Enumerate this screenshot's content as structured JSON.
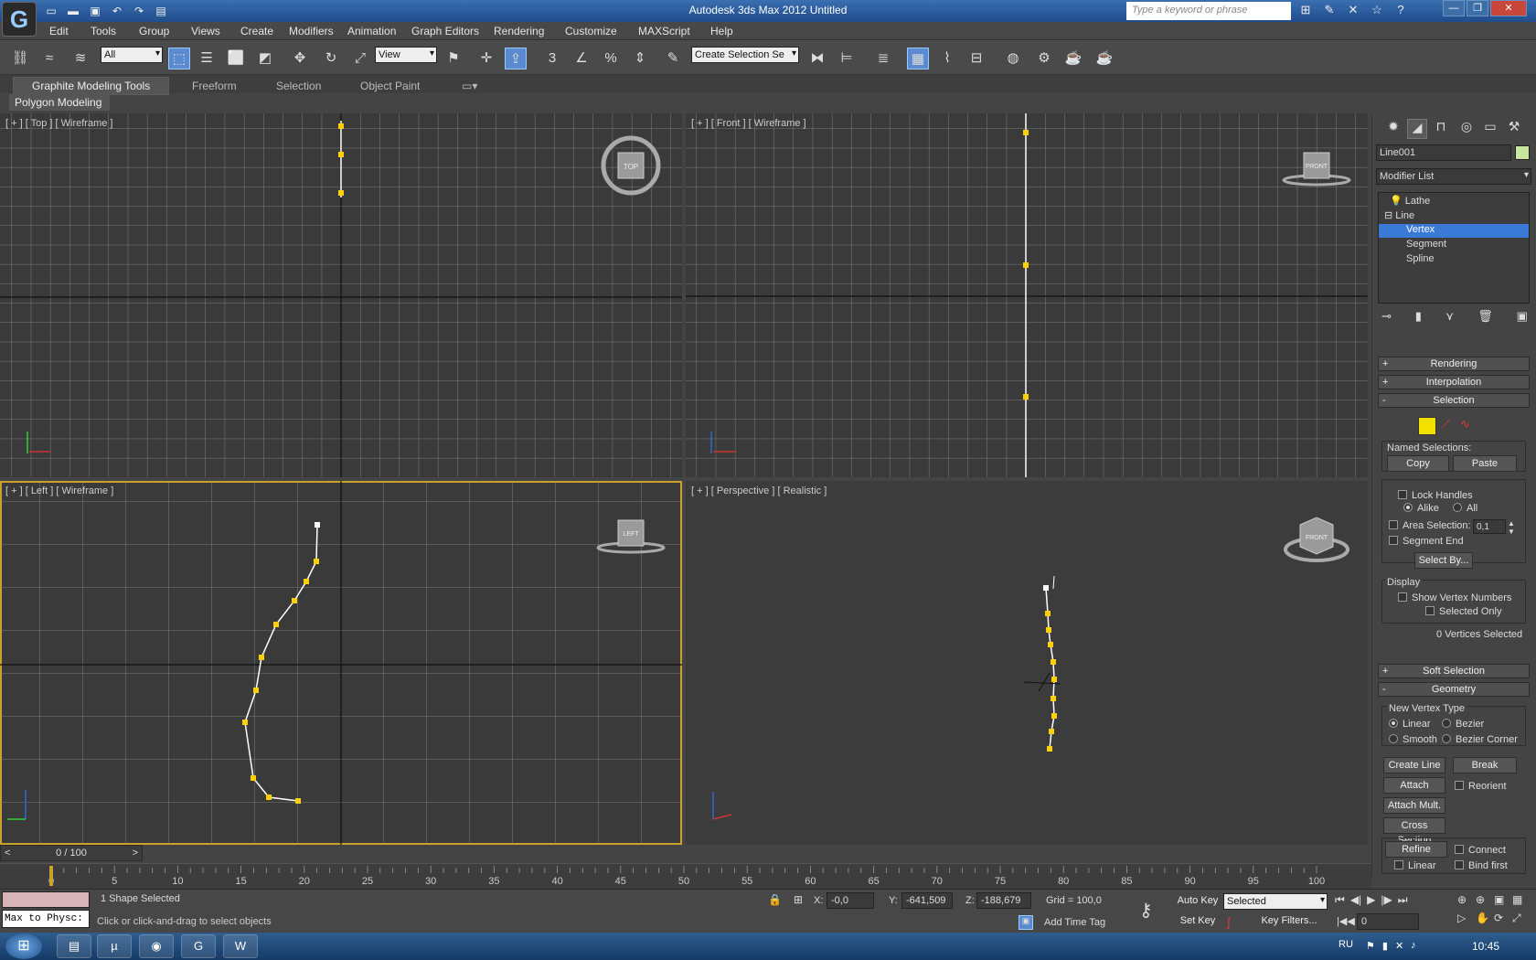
{
  "window": {
    "title": "Autodesk 3ds Max  2012     Untitled",
    "search_placeholder": "Type a keyword or phrase"
  },
  "menu": [
    "Edit",
    "Tools",
    "Group",
    "Views",
    "Create",
    "Modifiers",
    "Animation",
    "Graph Editors",
    "Rendering",
    "Customize",
    "MAXScript",
    "Help"
  ],
  "toolbar": {
    "filter": "All",
    "ref_coord": "View",
    "selection_set": "Create Selection Se"
  },
  "ribbon": {
    "tabs": [
      "Graphite Modeling Tools",
      "Freeform",
      "Selection",
      "Object Paint"
    ],
    "panel": "Polygon Modeling"
  },
  "viewports": {
    "top": {
      "label": "[ + ] [ Top ] [ Wireframe ]",
      "cube": "TOP"
    },
    "front": {
      "label": "[ + ] [ Front ] [ Wireframe ]",
      "cube": "FRONT"
    },
    "left": {
      "label": "[ + ] [ Left ] [ Wireframe ]",
      "cube": "LEFT"
    },
    "persp": {
      "label": "[ + ] [ Perspective ] [ Realistic ]",
      "cube": "FRONT"
    }
  },
  "panel": {
    "object_name": "Line001",
    "modifier_list": "Modifier List",
    "stack": [
      {
        "label": "Lathe"
      },
      {
        "label": "Line"
      },
      {
        "label": "Vertex"
      },
      {
        "label": "Segment"
      },
      {
        "label": "Spline"
      }
    ],
    "rollouts": {
      "rendering": "Rendering",
      "interpolation": "Interpolation",
      "selection": "Selection",
      "soft_selection": "Soft Selection",
      "geometry": "Geometry"
    },
    "selection": {
      "named": "Named Selections:",
      "copy": "Copy",
      "paste": "Paste",
      "lock_handles": "Lock Handles",
      "alike": "Alike",
      "all": "All",
      "area_selection": "Area Selection:",
      "area_value": "0,1",
      "segment_end": "Segment End",
      "select_by": "Select By...",
      "display": "Display",
      "show_vertex_numbers": "Show Vertex Numbers",
      "selected_only": "Selected Only",
      "status": "0 Vertices Selected"
    },
    "geometry": {
      "new_vertex_type": "New Vertex Type",
      "linear": "Linear",
      "bezier": "Bezier",
      "smooth": "Smooth",
      "bezier_corner": "Bezier Corner",
      "create_line": "Create Line",
      "break": "Break",
      "attach": "Attach",
      "reorient": "Reorient",
      "attach_mult": "Attach Mult.",
      "cross_section": "Cross Section",
      "refine": "Refine",
      "connect": "Connect",
      "linear2": "Linear",
      "bind_first": "Bind first"
    }
  },
  "timeline": {
    "frame": "0 / 100",
    "ticks": [
      "0",
      "5",
      "10",
      "15",
      "20",
      "25",
      "30",
      "35",
      "40",
      "45",
      "50",
      "55",
      "60",
      "65",
      "70",
      "75",
      "80",
      "85",
      "90",
      "95",
      "100"
    ]
  },
  "status": {
    "script": "Max to Physc:",
    "selected": "1 Shape Selected",
    "prompt": "Click or click-and-drag to select objects",
    "x_label": "X:",
    "x": "-0,0",
    "y_label": "Y:",
    "y": "-641,509",
    "z_label": "Z:",
    "z": "-188,679",
    "grid": "Grid = 100,0",
    "add_time_tag": "Add Time Tag",
    "auto_key": "Auto Key",
    "set_key": "Set Key",
    "key_mode": "Selected",
    "key_filters": "Key Filters...",
    "frame_field": "0"
  },
  "taskbar": {
    "lang": "RU",
    "time": "10:45"
  }
}
